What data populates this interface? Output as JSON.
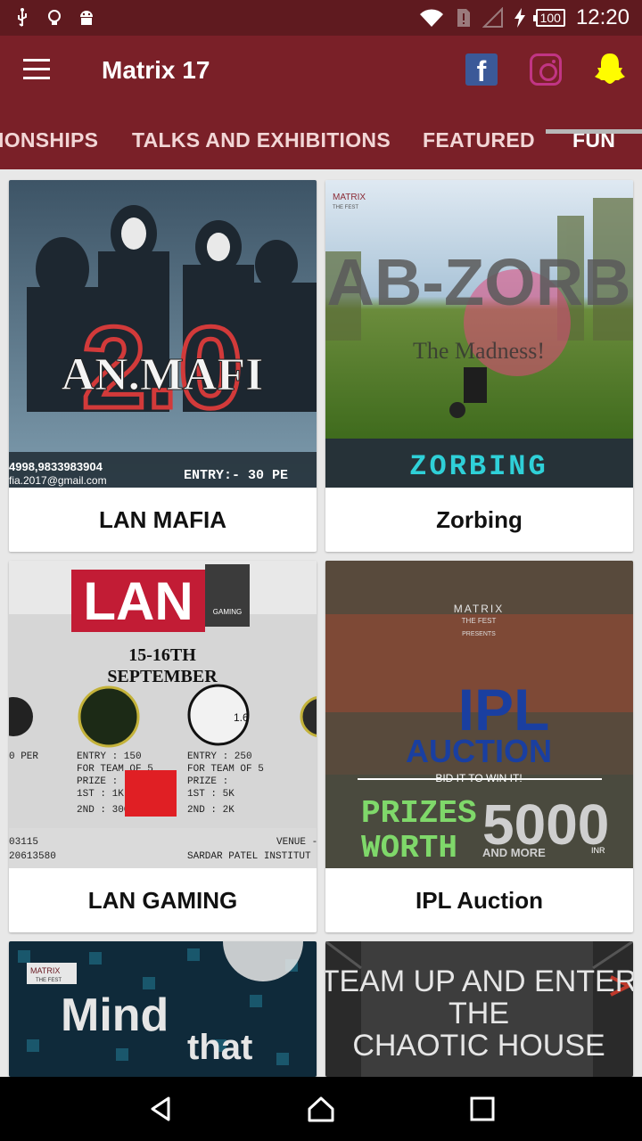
{
  "status_bar": {
    "left_icons": [
      "usb-icon",
      "lightbulb-icon",
      "android-icon"
    ],
    "battery": "100",
    "time": "12:20"
  },
  "app_bar": {
    "title": "Matrix 17",
    "social_icons": [
      "facebook-icon",
      "instagram-icon",
      "snapchat-icon"
    ]
  },
  "tabs": [
    {
      "label": "IONSHIPS",
      "active": false
    },
    {
      "label": "TALKS AND EXHIBITIONS",
      "active": false
    },
    {
      "label": "FEATURED",
      "active": false
    },
    {
      "label": "FUN",
      "active": true
    }
  ],
  "cards": [
    {
      "label": "LAN MAFIA",
      "poster": {
        "headline": "AN.MAFI",
        "big": "2.0",
        "contact": "4998,9833983904",
        "email": "fia.2017@gmail.com",
        "entry": "ENTRY:- 30 PE"
      }
    },
    {
      "label": "Zorbing",
      "poster": {
        "brand": "MATRIX",
        "brand_sub": "THE FEST",
        "headline": "AB-ZORB",
        "tagline": "The Madness!",
        "banner": "ZORBING"
      }
    },
    {
      "label": "LAN GAMING",
      "poster": {
        "logo": "LAN",
        "logo_sub": "GAMING",
        "date": "15-16TH",
        "month": "SEPTEMBER",
        "col1": "0 PER",
        "col2a": "ENTRY : 150",
        "col2b": "FOR TEAM OF 5",
        "col2c": "PRIZE :",
        "col2d": "1ST : 1K",
        "col2e": "2ND : 300",
        "col3a": "ENTRY : 250",
        "col3b": "FOR TEAM OF 5",
        "col3c": "PRIZE :",
        "col3d": "1ST : 5K",
        "col3e": "2ND : 2K",
        "phone1": "03115",
        "phone2": "20613580",
        "venue": "VENUE -",
        "venue2": "SARDAR PATEL INSTITUT",
        "badge": "1.6"
      }
    },
    {
      "label": "IPL Auction",
      "poster": {
        "brand": "MATRIX",
        "brand_sub": "THE FEST",
        "presents": "PRESENTS",
        "headline": "IPL",
        "sub": "AUCTION",
        "tagline": "BID IT TO WIN IT!",
        "prizes1": "PRIZES",
        "prizes2": "WORTH",
        "amount": "5000",
        "and_more": "AND MORE",
        "inr": "INR"
      }
    },
    {
      "label": "",
      "poster": {
        "brand": "MATRIX",
        "brand_sub": "THE FEST",
        "line1": "Mind",
        "line2": "that"
      }
    },
    {
      "label": "",
      "poster": {
        "line1": "TEAM UP AND ENTER",
        "line2": "THE",
        "line3": "CHAOTIC HOUSE"
      }
    }
  ],
  "colors": {
    "status_bar": "#5f1a1f",
    "app_bar": "#7a2028",
    "background": "#e8e8e8"
  }
}
